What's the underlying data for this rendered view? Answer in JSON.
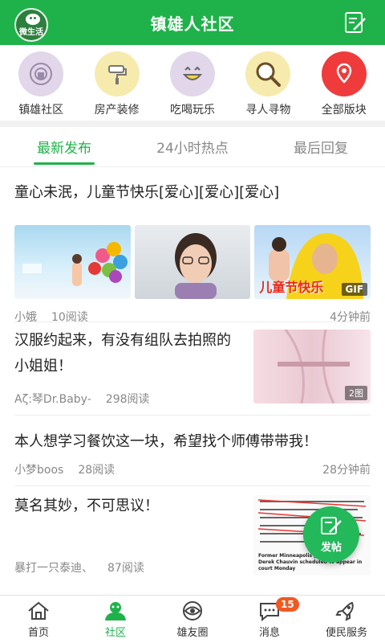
{
  "header": {
    "logo_text": "微生活",
    "title": "镇雄人社区"
  },
  "categories": [
    {
      "label": "镇雄社区",
      "icon": "community-icon",
      "color": "#e2d6ea"
    },
    {
      "label": "房产装修",
      "icon": "paint-roller-icon",
      "color": "#f6ebac"
    },
    {
      "label": "吃喝玩乐",
      "icon": "smiley-icon",
      "color": "#e2d6ea"
    },
    {
      "label": "寻人寻物",
      "icon": "magnifier-icon",
      "color": "#f6ebac"
    },
    {
      "label": "全部版块",
      "icon": "location-pin-icon",
      "color": "#ef3b3b"
    }
  ],
  "tabs": [
    {
      "label": "最新发布",
      "active": true
    },
    {
      "label": "24小时热点",
      "active": false
    },
    {
      "label": "最后回复",
      "active": false
    }
  ],
  "posts": [
    {
      "title": "童心未泯，儿童节快乐[爱心][爱心][爱心]",
      "author": "小娥",
      "reads": "10阅读",
      "time": "4分钟前",
      "thumb_text": "儿童节快乐",
      "badge": "GIF"
    },
    {
      "title": "汉服约起来，有没有组队去拍照的小姐姐！",
      "author": "Aζ:琴Dr.Baby-",
      "reads": "298阅读",
      "badge": "2图"
    },
    {
      "title": "本人想学习餐饮这一块，希望找个师傅带带我！",
      "author": "小梦boos",
      "reads": "28阅读",
      "time": "28分钟前"
    },
    {
      "title": "莫名其妙，不可思议！",
      "author": "暴打一只泰迪、",
      "reads": "87阅读",
      "thumb_caption": "Former Minneapolis police officer Derek Chauvin scheduled to appear in court Monday"
    }
  ],
  "fab": {
    "label": "发帖"
  },
  "bottom_nav": [
    {
      "label": "首页",
      "icon": "home-icon",
      "active": false
    },
    {
      "label": "社区",
      "icon": "community-tab-icon",
      "active": true
    },
    {
      "label": "雄友圈",
      "icon": "eye-circle-icon",
      "active": false
    },
    {
      "label": "消息",
      "icon": "message-icon",
      "active": false,
      "badge": "15"
    },
    {
      "label": "便民服务",
      "icon": "rocket-icon",
      "active": false
    }
  ],
  "colors": {
    "brand": "#1fb24a",
    "badge": "#f05a22"
  }
}
